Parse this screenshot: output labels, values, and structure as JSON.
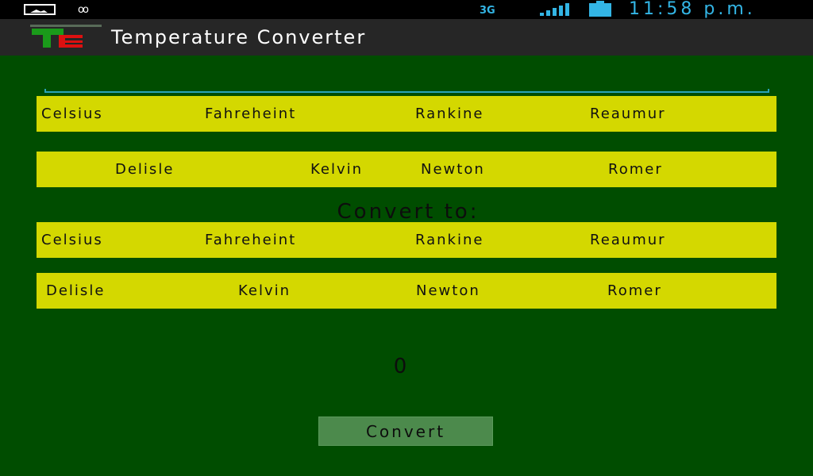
{
  "status_bar": {
    "network": "3G",
    "time": "11:58 p.m."
  },
  "app_bar": {
    "title": "Temperature Converter"
  },
  "from_units": {
    "row1": [
      "Celsius",
      "Fahreheint",
      "Rankine",
      "Reaumur"
    ],
    "row2": [
      "Delisle",
      "Kelvin",
      "Newton",
      "Romer"
    ]
  },
  "convert_to_label": "Convert to:",
  "to_units": {
    "row1": [
      "Celsius",
      "Fahreheint",
      "Rankine",
      "Reaumur"
    ],
    "row2": [
      "Delisle",
      "Kelvin",
      "Newton",
      "Romer"
    ]
  },
  "result_value": "0",
  "convert_button_label": "Convert",
  "colors": {
    "background": "#004d00",
    "option_row": "#d4d800",
    "accent": "#33b5e5"
  }
}
